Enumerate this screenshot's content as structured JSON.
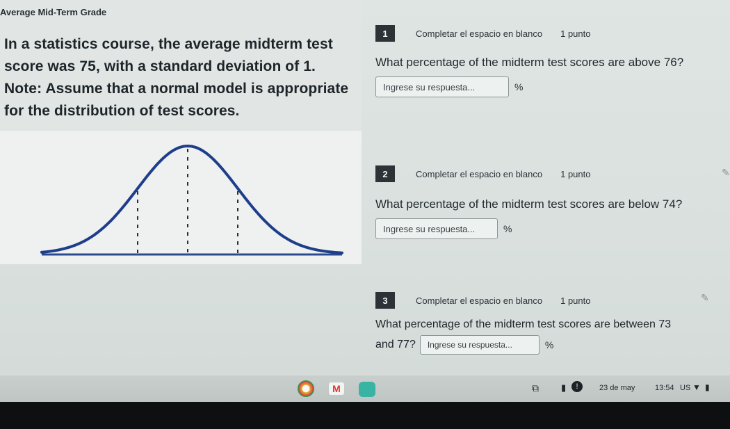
{
  "page": {
    "header_title": "Average Mid-Term Grade",
    "problem_text": "In a statistics course, the average midterm test score was 75, with a standard deviation of 1. Note: Assume that a normal model is appropriate for the distribution of test scores."
  },
  "questions": [
    {
      "number": "1",
      "type": "Completar el espacio en blanco",
      "points": "1 punto",
      "text": "What percentage of the midterm test scores are above 76?",
      "placeholder": "Ingrese su respuesta...",
      "unit": "%"
    },
    {
      "number": "2",
      "type": "Completar el espacio en blanco",
      "points": "1 punto",
      "text": "What percentage of the midterm test scores are below 74?",
      "placeholder": "Ingrese su respuesta...",
      "unit": "%"
    },
    {
      "number": "3",
      "type": "Completar el espacio en blanco",
      "points": "1 punto",
      "text_line1": "What percentage of the midterm test scores are between 73",
      "text_line2": "and 77?",
      "placeholder": "Ingrese su respuesta...",
      "unit": "%"
    }
  ],
  "taskbar": {
    "date": "23 de may",
    "time": "13:54",
    "locale": "US"
  },
  "colors": {
    "curve": "#1e3e8c",
    "dashes": "#2b2f33",
    "badge": "#2c3236"
  }
}
